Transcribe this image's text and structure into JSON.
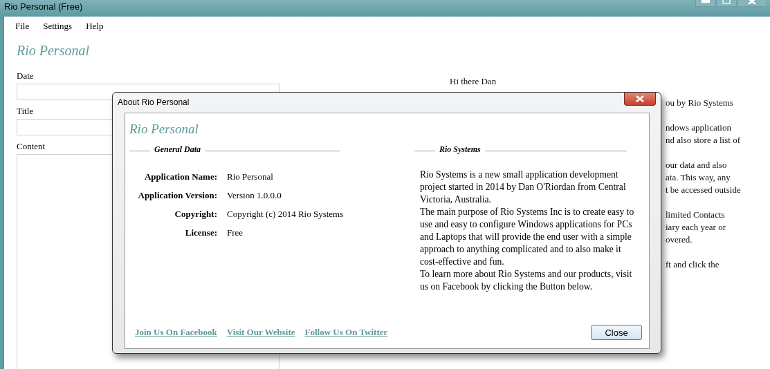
{
  "window": {
    "title": "Rio Personal (Free)"
  },
  "menu": [
    {
      "label": "File"
    },
    {
      "label": "Settings"
    },
    {
      "label": "Help"
    }
  ],
  "app_title": "Rio Personal",
  "fields": [
    {
      "label": "Date",
      "kind": "line"
    },
    {
      "label": "Title",
      "kind": "line"
    },
    {
      "label": "Content",
      "kind": "area"
    }
  ],
  "greeting": "Hi there Dan",
  "background_paragraphs": [
    [
      "ou by Rio Systems"
    ],
    [
      "ndows application",
      "nd also store a list of"
    ],
    [
      "our data and also",
      "ata. This way, any",
      "t be accessed outside"
    ],
    [
      "limited Contacts",
      "iary each year or",
      "overed."
    ],
    [
      "ft and click the"
    ]
  ],
  "dialog": {
    "title": "About Rio Personal",
    "heading": "Rio Personal",
    "general": {
      "title": "General Data",
      "rows": [
        {
          "label": "Application Name:",
          "value": "Rio Personal"
        },
        {
          "label": "Application Version:",
          "value": "Version 1.0.0.0"
        },
        {
          "label": "Copyright:",
          "value": "Copyright (c) 2014 Rio Systems"
        },
        {
          "label": "License:",
          "value": "Free"
        }
      ]
    },
    "about": {
      "title": "Rio Systems",
      "paragraphs": [
        "Rio Systems is a new small application development project started in 2014 by Dan O'Riordan from Central Victoria, Australia.",
        "The main purpose of Rio Systems Inc is to create easy to use and easy to configure Windows applications for PCs and Laptops that will provide the end user with a simple approach to anything complicated and to also make it cost-effective and fun.",
        "To learn more about Rio Systems and our products, visit us on Facebook by clicking the Button below."
      ]
    },
    "links": [
      "Join Us On Facebook",
      "Visit Our Website",
      "Follow Us On Twitter"
    ],
    "button": "Close"
  }
}
